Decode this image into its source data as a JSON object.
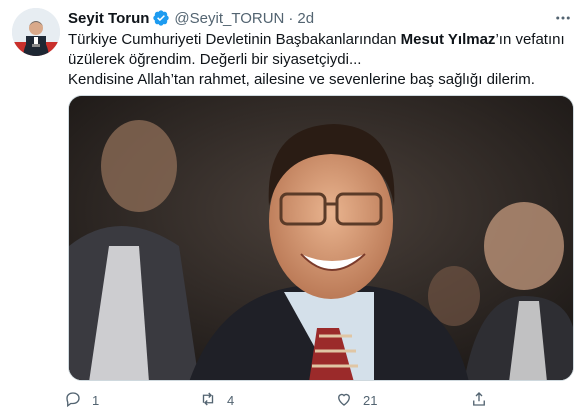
{
  "tweet": {
    "author_name": "Seyit Torun",
    "handle": "@Seyit_TORUN",
    "separator": "·",
    "time": "2d",
    "text_part1": "Türkiye Cumhuriyeti Devletinin Başbakanlarından ",
    "text_bold": "Mesut Yılmaz",
    "text_part2": "’ın vefatını üzülerek öğrendim. Değerli bir siyasetçiydi...",
    "text_line3": "Kendisine Allah’tan rahmet, ailesine ve sevenlerine baş sağlığı dilerim."
  },
  "actions": {
    "reply_count": "1",
    "retweet_count": "4",
    "like_count": "21",
    "share_count": ""
  },
  "icons": {
    "verified": "verified-badge-icon",
    "more": "more-dots-icon",
    "reply": "reply-icon",
    "retweet": "retweet-icon",
    "like": "heart-icon",
    "share": "share-icon"
  },
  "colors": {
    "verified_blue": "#1d9bf0",
    "secondary_text": "#536471",
    "primary_text": "#0f1419"
  }
}
